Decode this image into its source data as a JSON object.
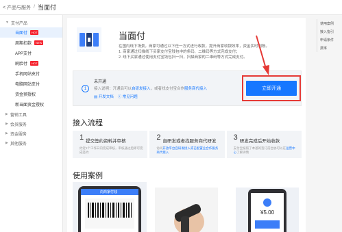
{
  "topbar": {
    "back_text": "< 产品与服务",
    "separator": "/",
    "current": "当面付"
  },
  "sidebar": {
    "groups": [
      {
        "label": "支付产品",
        "items": [
          {
            "label": "当面付",
            "active": true,
            "badge": "HOT"
          },
          {
            "label": "周期扣款",
            "badge": "NEW"
          },
          {
            "label": "APP支付"
          },
          {
            "label": "刷脸付",
            "badge": "HOT"
          },
          {
            "label": "手机网站支付"
          },
          {
            "label": "电脑网站支付"
          },
          {
            "label": "资金预授权"
          },
          {
            "label": "新当面资金授权"
          }
        ]
      },
      {
        "label": "营销工具"
      },
      {
        "label": "会员服务"
      },
      {
        "label": "资金服务"
      },
      {
        "label": "其他服务"
      }
    ]
  },
  "right_nav": [
    "使用案例",
    "接入指引",
    "申请条件",
    "费率"
  ],
  "product": {
    "title": "当面付",
    "desc_line1": "在国内线下场景，商家可通过以下任一方式进行收款，提升商家收银效率，资金实时到账。",
    "desc_line2": "1. 商家通过扫描线下买家支付宝钱包中的条码、二维码等方式完成支付；",
    "desc_line3": "2. 线下买家通过使用支付宝钱包扫一扫，扫描商家的二维码等方式完成支付。"
  },
  "status": {
    "step": "1",
    "title": "未开通",
    "sub_prefix": "接入说明：开通后可以",
    "sub_link1": "自研发接入",
    "sub_mid": "，或者找支付宝合作",
    "sub_link2": "服务商代接入",
    "link_docs": "开发文档",
    "link_faq": "常见问题",
    "open_button": "立即开通"
  },
  "flow": {
    "title": "接入流程",
    "steps": [
      {
        "num": "1",
        "title": "提交签约资料并审核",
        "desc": "约近1个工作日内完成审核，审核通过后即可完成签约"
      },
      {
        "num": "2",
        "title": "自研发或者找服务商代研发",
        "desc_prefix": "访问",
        "desc_link": "开放平台自研发接入或已配置业合作服务商代接入",
        "desc_suffix": ""
      },
      {
        "num": "3",
        "title": "研发完成后开始收款",
        "desc_prefix": "支付宝按照了本基的签订前台协可以在",
        "desc_link": "运营中心",
        "desc_suffix": "了解详情"
      }
    ]
  },
  "cases": {
    "title": "使用案例",
    "case1_header": "向商家付钱",
    "case3_amount": "¥5.00"
  },
  "colors": {
    "accent": "#1677ff",
    "hot": "#f5222d",
    "highlight": "#e53935"
  }
}
